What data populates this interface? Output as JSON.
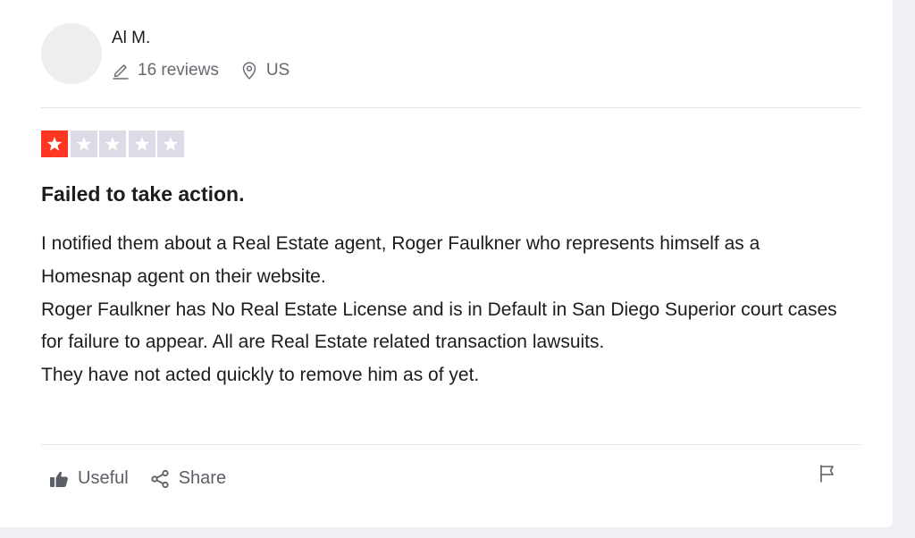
{
  "reviewer": {
    "name": "Al M.",
    "reviews_count": "16 reviews",
    "location": "US"
  },
  "rating": {
    "value": 1,
    "max": 5,
    "active_color": "#ff3722",
    "inactive_color": "#dcdce6"
  },
  "review": {
    "title": "Failed to take action.",
    "paragraphs": [
      "I notified them about a Real Estate agent, Roger Faulkner who represents himself as a Homesnap agent on their website.",
      "Roger Faulkner has No Real Estate License and is in Default in San Diego Superior court cases for failure to appear. All are Real Estate related transaction lawsuits.",
      "They have not acted quickly to remove him as of yet."
    ]
  },
  "actions": {
    "useful_label": "Useful",
    "share_label": "Share"
  },
  "icons": {
    "reviews": "pencil-icon",
    "location": "location-pin-icon",
    "useful": "thumbs-up-icon",
    "share": "share-icon",
    "report": "flag-icon"
  }
}
